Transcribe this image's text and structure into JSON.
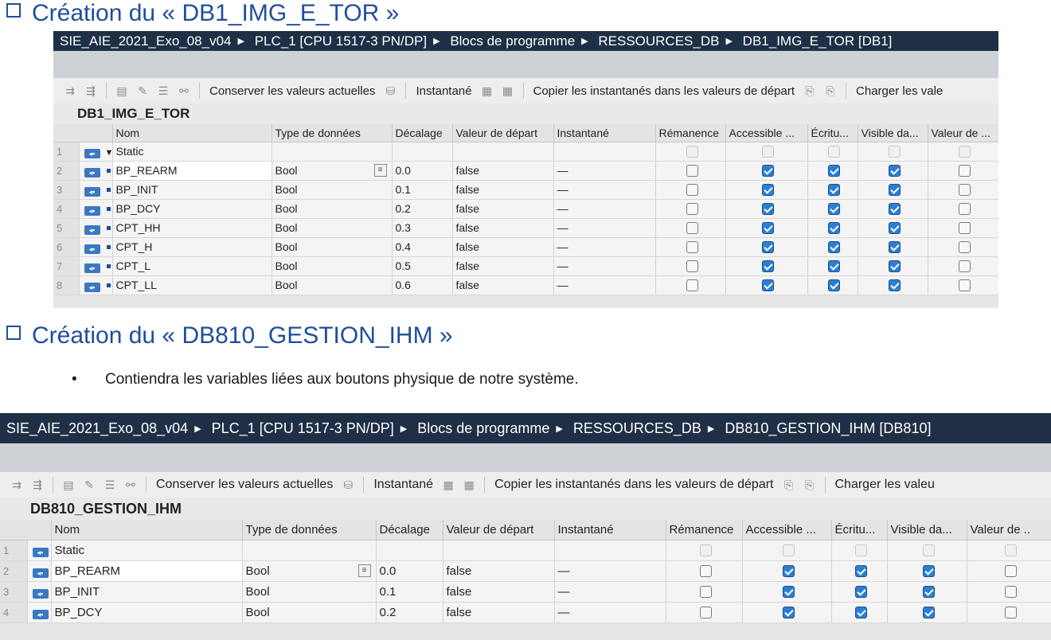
{
  "heading1": "Création du « DB1_IMG_E_TOR »",
  "heading2": "Création du « DB810_GESTION_IHM »",
  "bullet": "Contiendra les variables liées aux boutons physique de notre système.",
  "colors": {
    "heading": "#1f4e9c",
    "path_bar": "#1f2f46",
    "checkbox_on": "#2a7fd4"
  },
  "shot1": {
    "path": [
      "SIE_AIE_2021_Exo_08_v04",
      "PLC_1 [CPU 1517-3 PN/DP]",
      "Blocs de programme",
      "RESSOURCES_DB",
      "DB1_IMG_E_TOR [DB1]"
    ],
    "toolbar": {
      "keep": "Conserver les valeurs actuelles",
      "snapshot": "Instantané",
      "copy": "Copier les instantanés dans les valeurs de départ",
      "load": "Charger les vale"
    },
    "db_name": "DB1_IMG_E_TOR",
    "columns": [
      "Nom",
      "Type de données",
      "Décalage",
      "Valeur de départ",
      "Instantané",
      "Rémanence",
      "Accessible ...",
      "Écritu...",
      "Visible da...",
      "Valeur de ..."
    ],
    "static_label": "Static",
    "rows": [
      {
        "num": "2",
        "name": "BP_REARM",
        "type": "Bool",
        "offset": "0.0",
        "start": "false",
        "snap": "—"
      },
      {
        "num": "3",
        "name": "BP_INIT",
        "type": "Bool",
        "offset": "0.1",
        "start": "false",
        "snap": "—"
      },
      {
        "num": "4",
        "name": "BP_DCY",
        "type": "Bool",
        "offset": "0.2",
        "start": "false",
        "snap": "—"
      },
      {
        "num": "5",
        "name": "CPT_HH",
        "type": "Bool",
        "offset": "0.3",
        "start": "false",
        "snap": "—"
      },
      {
        "num": "6",
        "name": "CPT_H",
        "type": "Bool",
        "offset": "0.4",
        "start": "false",
        "snap": "—"
      },
      {
        "num": "7",
        "name": "CPT_L",
        "type": "Bool",
        "offset": "0.5",
        "start": "false",
        "snap": "—"
      },
      {
        "num": "8",
        "name": "CPT_LL",
        "type": "Bool",
        "offset": "0.6",
        "start": "false",
        "snap": "—"
      }
    ]
  },
  "shot2": {
    "path": [
      "SIE_AIE_2021_Exo_08_v04",
      "PLC_1 [CPU 1517-3 PN/DP]",
      "Blocs de programme",
      "RESSOURCES_DB",
      "DB810_GESTION_IHM [DB810]"
    ],
    "toolbar": {
      "keep": "Conserver les valeurs actuelles",
      "snapshot": "Instantané",
      "copy": "Copier les instantanés dans les valeurs de départ",
      "load": "Charger les valeu"
    },
    "db_name": "DB810_GESTION_IHM",
    "columns": [
      "Nom",
      "Type de données",
      "Décalage",
      "Valeur de départ",
      "Instantané",
      "Rémanence",
      "Accessible ...",
      "Écritu...",
      "Visible da...",
      "Valeur de .."
    ],
    "static_label": "Static",
    "rows": [
      {
        "num": "2",
        "name": "BP_REARM",
        "type": "Bool",
        "offset": "0.0",
        "start": "false",
        "snap": "—"
      },
      {
        "num": "3",
        "name": "BP_INIT",
        "type": "Bool",
        "offset": "0.1",
        "start": "false",
        "snap": "—"
      },
      {
        "num": "4",
        "name": "BP_DCY",
        "type": "Bool",
        "offset": "0.2",
        "start": "false",
        "snap": "—"
      }
    ]
  }
}
